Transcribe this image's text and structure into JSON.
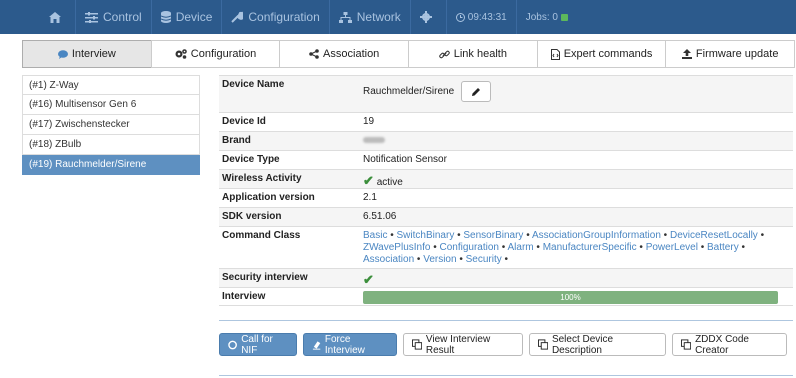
{
  "topnav": {
    "home_icon": "home-icon",
    "items": [
      {
        "label": "Control",
        "icon": "sliders-icon"
      },
      {
        "label": "Device",
        "icon": "database-icon"
      },
      {
        "label": "Configuration",
        "icon": "wrench-icon"
      },
      {
        "label": "Network",
        "icon": "sitemap-icon"
      }
    ],
    "settings_icon": "gear-icon",
    "clock": "09:43:31",
    "jobs": "Jobs: 0"
  },
  "tabs": [
    {
      "label": "Interview",
      "icon": "chat-icon",
      "active": true
    },
    {
      "label": "Configuration",
      "icon": "cogs-icon"
    },
    {
      "label": "Association",
      "icon": "share-icon"
    },
    {
      "label": "Link health",
      "icon": "link-icon"
    },
    {
      "label": "Expert commands",
      "icon": "file-code-icon"
    },
    {
      "label": "Firmware update",
      "icon": "upload-icon"
    }
  ],
  "devices": [
    "(#1) Z-Way",
    "(#16) Multisensor Gen 6",
    "(#17) Zwischenstecker",
    "(#18) ZBulb",
    "(#19) Rauchmelder/Sirene"
  ],
  "info": {
    "device_name_label": "Device Name",
    "device_name": "Rauchmelder/Sirene",
    "device_id_label": "Device Id",
    "device_id": "19",
    "brand_label": "Brand",
    "device_type_label": "Device Type",
    "device_type": "Notification Sensor",
    "wireless_label": "Wireless Activity",
    "wireless": "active",
    "app_version_label": "Application version",
    "app_version": "2.1",
    "sdk_label": "SDK version",
    "sdk": "6.51.06",
    "cc_label": "Command Class",
    "command_classes": [
      "Basic",
      "SwitchBinary",
      "SensorBinary",
      "AssociationGroupInformation",
      "DeviceResetLocally",
      "ZWavePlusInfo",
      "Configuration",
      "Alarm",
      "ManufacturerSpecific",
      "PowerLevel",
      "Battery",
      "Association",
      "Version",
      "Security"
    ],
    "security_label": "Security interview",
    "interview_label": "Interview",
    "interview_progress": "100%"
  },
  "buttons": {
    "call_nif": "Call for NIF",
    "force_interview": "Force Interview",
    "view_result": "View Interview Result",
    "select_desc": "Select Device Description",
    "zddx": "ZDDX Code Creator"
  },
  "colors": {
    "topbar": "#2c5a8c",
    "accent": "#5e90c1",
    "success": "#3c8f3c"
  }
}
